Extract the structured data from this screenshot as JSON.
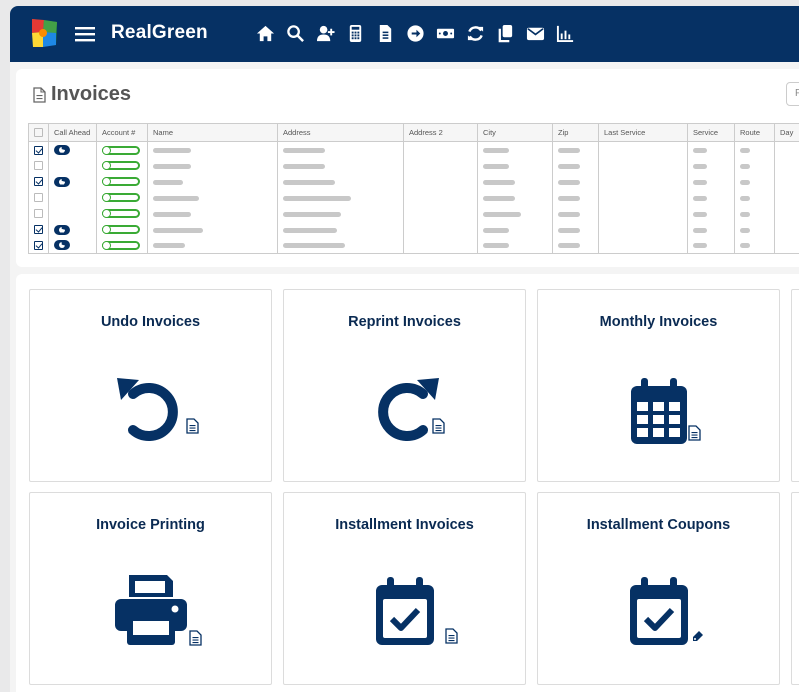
{
  "app": {
    "brand": "RealGreen",
    "colors": {
      "navy": "#063164",
      "green": "#3aaa35",
      "tile_title": "#0a2a52"
    },
    "nav_icons": [
      "home-icon",
      "search-icon",
      "add-user-icon",
      "calculator-icon",
      "document-icon",
      "arrow-circle-icon",
      "cash-icon",
      "sync-icon",
      "copy-icon",
      "mail-icon",
      "bar-chart-icon"
    ]
  },
  "invoices": {
    "title": "Invoices",
    "columns": [
      "",
      "Call Ahead",
      "Account #",
      "Name",
      "Address",
      "Address 2",
      "City",
      "Zip",
      "Last Service",
      "Service",
      "Route",
      "Day"
    ],
    "rows": [
      {
        "checked": true,
        "call_ahead": true,
        "name_w": 38,
        "addr_w": 42,
        "city_w": 26,
        "zip_w": 22
      },
      {
        "checked": false,
        "call_ahead": false,
        "name_w": 38,
        "addr_w": 42,
        "city_w": 26,
        "zip_w": 22
      },
      {
        "checked": true,
        "call_ahead": true,
        "name_w": 30,
        "addr_w": 52,
        "city_w": 32,
        "zip_w": 22
      },
      {
        "checked": false,
        "call_ahead": false,
        "name_w": 46,
        "addr_w": 68,
        "city_w": 32,
        "zip_w": 22
      },
      {
        "checked": false,
        "call_ahead": false,
        "name_w": 38,
        "addr_w": 58,
        "city_w": 38,
        "zip_w": 22
      },
      {
        "checked": true,
        "call_ahead": true,
        "name_w": 50,
        "addr_w": 54,
        "city_w": 26,
        "zip_w": 22
      },
      {
        "checked": true,
        "call_ahead": true,
        "name_w": 32,
        "addr_w": 62,
        "city_w": 26,
        "zip_w": 22
      }
    ]
  },
  "tiles": [
    {
      "label": "Undo Invoices",
      "icon": "undo-icon",
      "badge": "document-icon"
    },
    {
      "label": "Reprint Invoices",
      "icon": "redo-icon",
      "badge": "document-icon"
    },
    {
      "label": "Monthly Invoices",
      "icon": "calendar-grid-icon",
      "badge": "document-icon"
    },
    {
      "label": "Invoice Printing",
      "icon": "printer-icon",
      "badge": "document-icon"
    },
    {
      "label": "Installment Invoices",
      "icon": "calendar-check-icon",
      "badge": "document-icon"
    },
    {
      "label": "Installment Coupons",
      "icon": "calendar-check-icon",
      "badge": "tag-icon"
    }
  ]
}
